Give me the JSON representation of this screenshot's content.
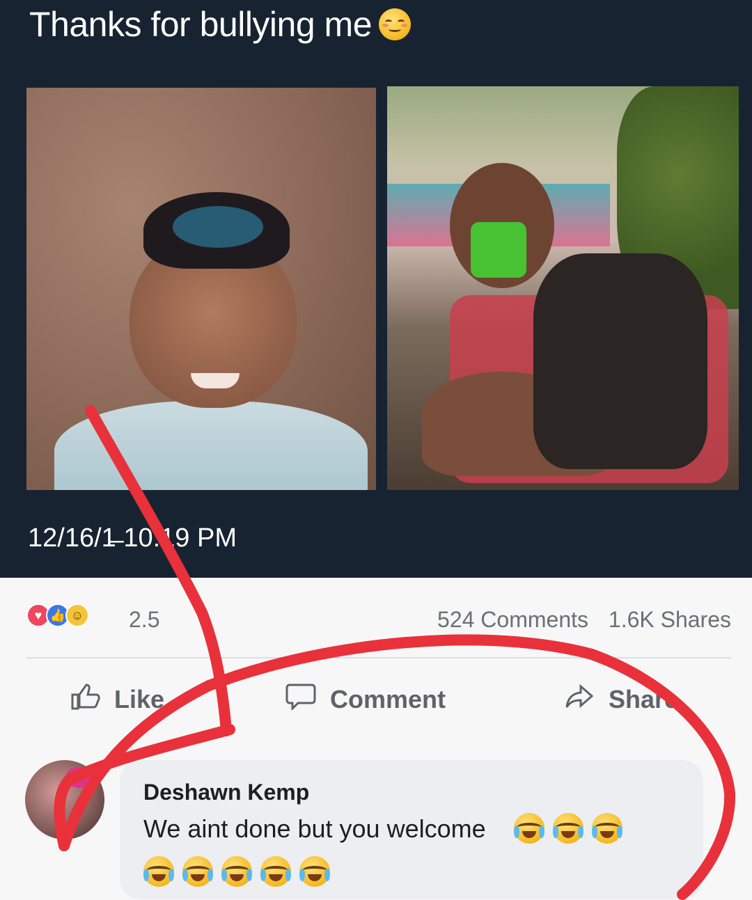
{
  "tweet": {
    "text": "Thanks for bullying me",
    "emoji": "smiling-face-with-blush",
    "timestamp": "12/16/1̶ 10:19 PM",
    "images": [
      {
        "name": "child-photo"
      },
      {
        "name": "adult-photo"
      }
    ]
  },
  "facebook": {
    "reactions": [
      "love",
      "like",
      "haha"
    ],
    "reaction_count": "2.5",
    "comments_count": "524 Comments",
    "shares_count": "1.6K Shares",
    "actions": {
      "like": "Like",
      "comment": "Comment",
      "share": "Share"
    },
    "comment": {
      "author": "Deshawn Kemp",
      "text": "We aint done but you welcome",
      "emoji": "loudly-crying-face",
      "emoji_count_line1": 3,
      "emoji_count_line2": 5
    }
  },
  "colors": {
    "tweet_bg": "#172331",
    "fb_bg": "#f7f7f8",
    "scribble": "#e8313a"
  }
}
